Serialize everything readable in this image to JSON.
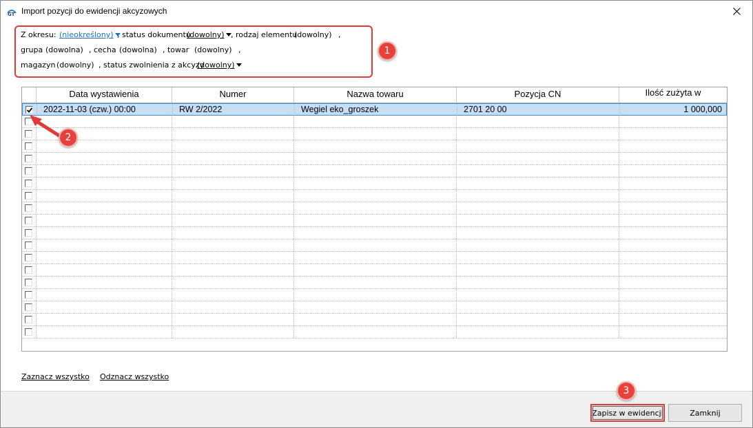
{
  "window": {
    "title": "Import pozycji do ewidencji akcyzowych"
  },
  "filters": {
    "period_label": "Z okresu:",
    "period_value": "(nieokreślony)",
    "doc_status_label": ", status dokumentu",
    "doc_status_value": "(dowolny)",
    "element_type_label": ", rodzaj elementu",
    "element_type_value": "(dowolny)",
    "comma": ",",
    "group_label": "grupa",
    "group_value": "(dowolna)",
    "feature_label": ", cecha",
    "feature_value": "(dowolna)",
    "goods_label": ", towar",
    "goods_value": "(dowolny)",
    "warehouse_label": "magazyn",
    "warehouse_value": "(dowolny)",
    "exemption_label": ", status zwolnienia z akcyzy",
    "exemption_value": "(dowolny)"
  },
  "markers": [
    "1",
    "2",
    "3"
  ],
  "table": {
    "columns": [
      "Data wystawienia",
      "Numer",
      "Nazwa towaru",
      "Pozycja CN",
      "Ilość zużyta w"
    ],
    "rows": [
      {
        "checked": true,
        "date": "2022-11-03 (czw.) 00:00",
        "number": "RW 2/2022",
        "name": "Wegiel eko_groszek",
        "cn": "2701 20 00",
        "qty": "1 000,000"
      }
    ]
  },
  "links": {
    "select_all": "Zaznacz wszystko",
    "deselect_all": "Odznacz wszystko"
  },
  "buttons": {
    "save": "Zapisz w ewidencji",
    "close": "Zamknij"
  },
  "colors": {
    "accent_red": "#e03a3a",
    "selection": "#c7def4",
    "link": "#1a6fc9"
  }
}
